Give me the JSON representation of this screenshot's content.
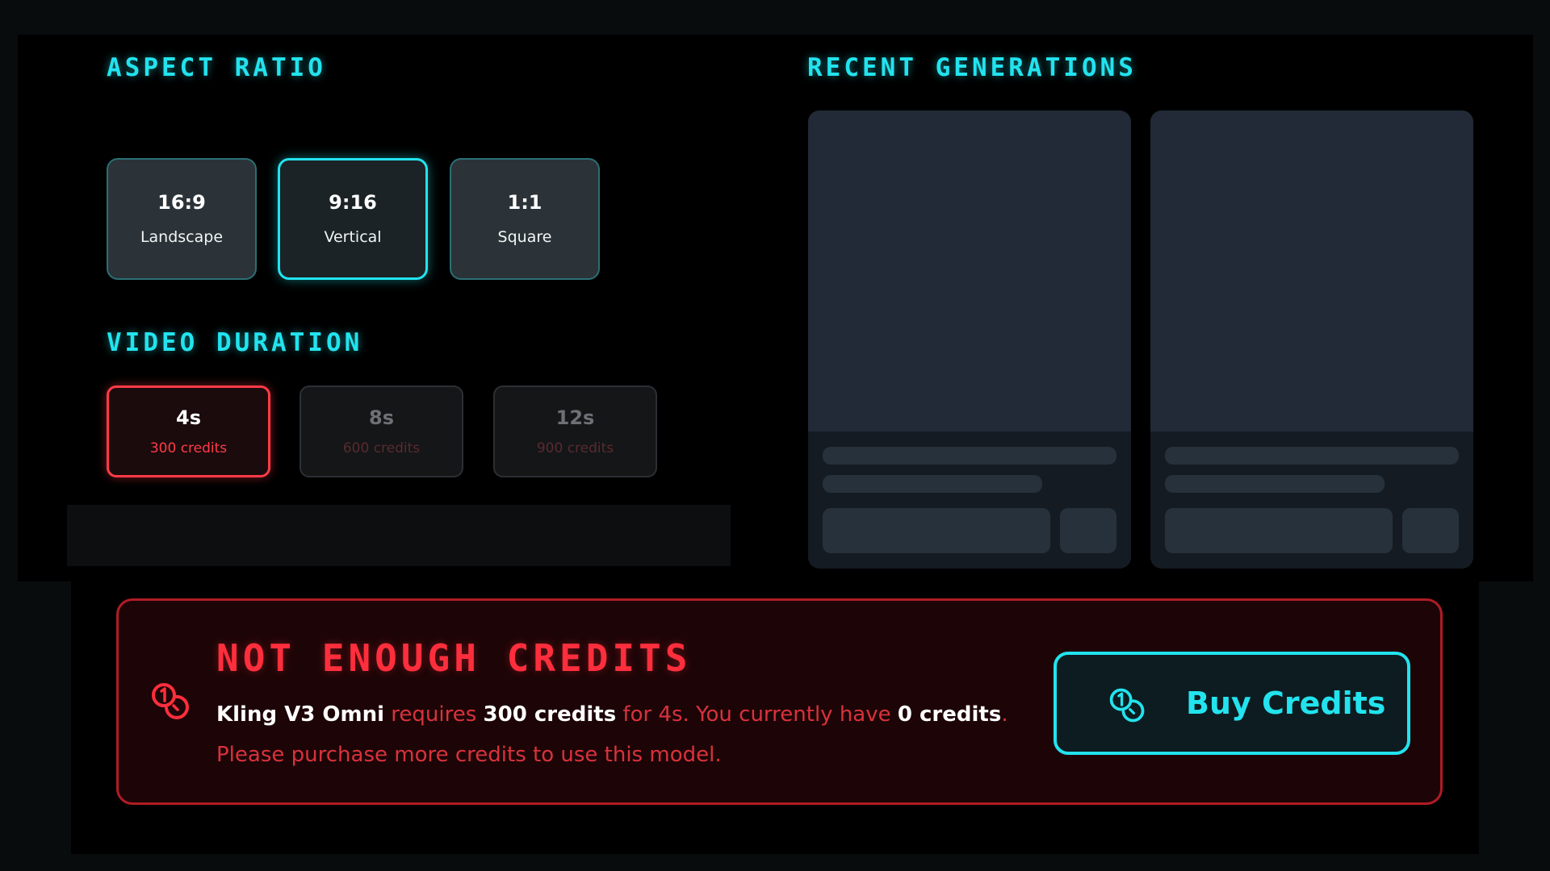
{
  "aspect_ratio": {
    "title": "ASPECT RATIO",
    "selected": "9:16",
    "options": [
      {
        "ratio": "16:9",
        "label": "Landscape"
      },
      {
        "ratio": "9:16",
        "label": "Vertical"
      },
      {
        "ratio": "1:1",
        "label": "Square"
      }
    ]
  },
  "video_duration": {
    "title": "VIDEO DURATION",
    "selected": "4s",
    "options": [
      {
        "duration": "4s",
        "credits": "300 credits"
      },
      {
        "duration": "8s",
        "credits": "600 credits"
      },
      {
        "duration": "12s",
        "credits": "900 credits"
      }
    ]
  },
  "recent_generations": {
    "title": "RECENT GENERATIONS",
    "state": "loading"
  },
  "alert": {
    "title": "NOT ENOUGH CREDITS",
    "model_name": "Kling V3 Omni",
    "text_requires": " requires ",
    "required_credits": "300 credits",
    "text_for": " for 4s. You currently have ",
    "current_credits": "0 credits",
    "text_end": ". Please purchase more credits to use this model.",
    "icon": "coins-icon"
  },
  "buy_button": {
    "label": "Buy Credits",
    "icon": "coins-icon"
  },
  "colors": {
    "accent_cyan": "#22e3ee",
    "alert_red": "#ff2e3c",
    "background": "#000000"
  }
}
